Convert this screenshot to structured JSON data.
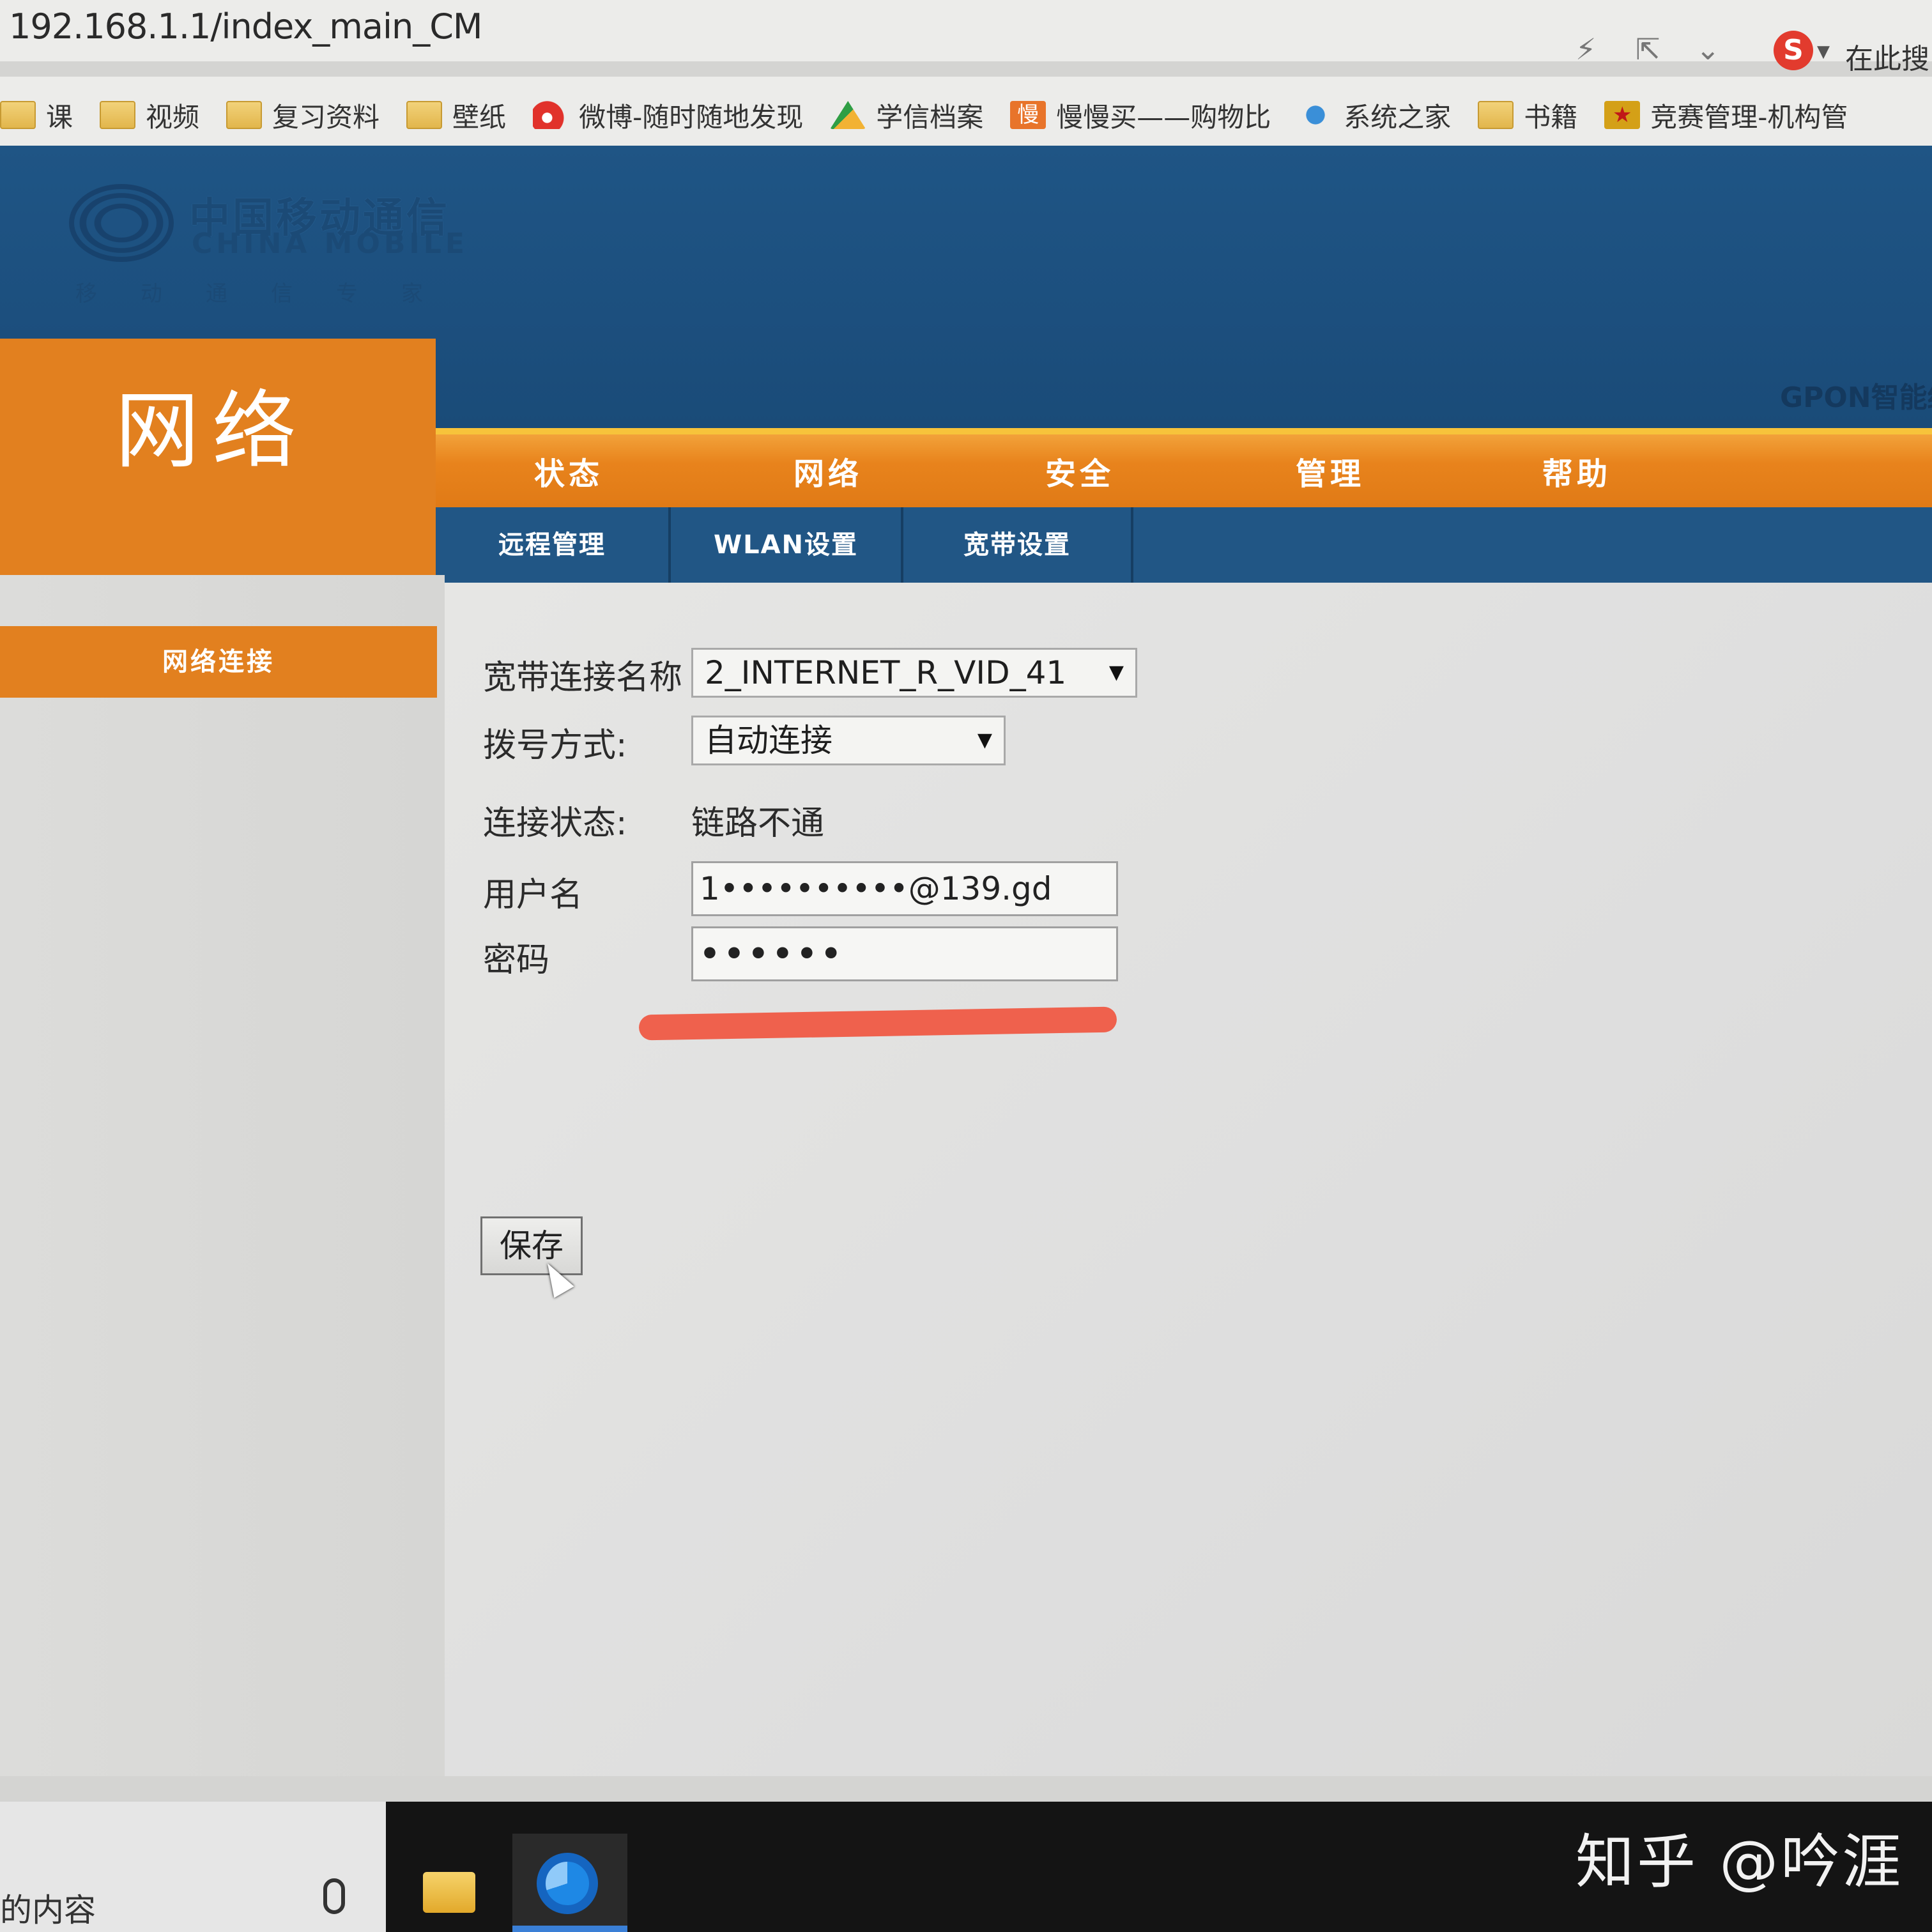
{
  "browser": {
    "url": "192.168.1.1/index_main_CM",
    "search_hint": "在此搜",
    "icons": [
      "lightning-icon",
      "share-icon",
      "chevron-down-icon",
      "sogou-icon"
    ],
    "sogou_glyph": "S",
    "bookmarks": [
      {
        "label": "课",
        "icon": "folder-icon"
      },
      {
        "label": "视频",
        "icon": "folder-icon"
      },
      {
        "label": "复习资料",
        "icon": "folder-icon"
      },
      {
        "label": "壁纸",
        "icon": "folder-icon"
      },
      {
        "label": "微博-随时随地发现",
        "icon": "weibo-icon"
      },
      {
        "label": "学信档案",
        "icon": "chsi-icon"
      },
      {
        "label": "慢慢买——购物比",
        "icon": "manmanmai-icon"
      },
      {
        "label": "系统之家",
        "icon": "xitong-icon"
      },
      {
        "label": "书籍",
        "icon": "folder-icon"
      },
      {
        "label": "竞赛管理-机构管",
        "icon": "jingsai-icon"
      }
    ]
  },
  "router": {
    "brand_cn": "中国移动通信",
    "brand_en": "CHINA MOBILE",
    "slogan": "移动通信专家",
    "product": "GPON智能终",
    "section_title": "网络",
    "main_nav": [
      "状态",
      "网络",
      "安全",
      "管理",
      "帮助"
    ],
    "sub_nav": [
      "远程管理",
      "WLAN设置",
      "宽带设置"
    ],
    "sidebar": [
      "网络连接"
    ],
    "form": {
      "connection_name_label": "宽带连接名称",
      "connection_name_value": "2_INTERNET_R_VID_41",
      "dial_mode_label": "拨号方式:",
      "dial_mode_value": "自动连接",
      "status_label": "连接状态:",
      "status_value": "链路不通",
      "username_label": "用户名",
      "username_value": "1••••••••••@139.gd",
      "password_label": "密码",
      "password_value": "••••••",
      "save_label": "保存"
    },
    "accent_orange": "#e2801f",
    "accent_blue": "#215685"
  },
  "taskbar": {
    "search_text": "的内容",
    "watermark": "知乎 @吟涯"
  }
}
